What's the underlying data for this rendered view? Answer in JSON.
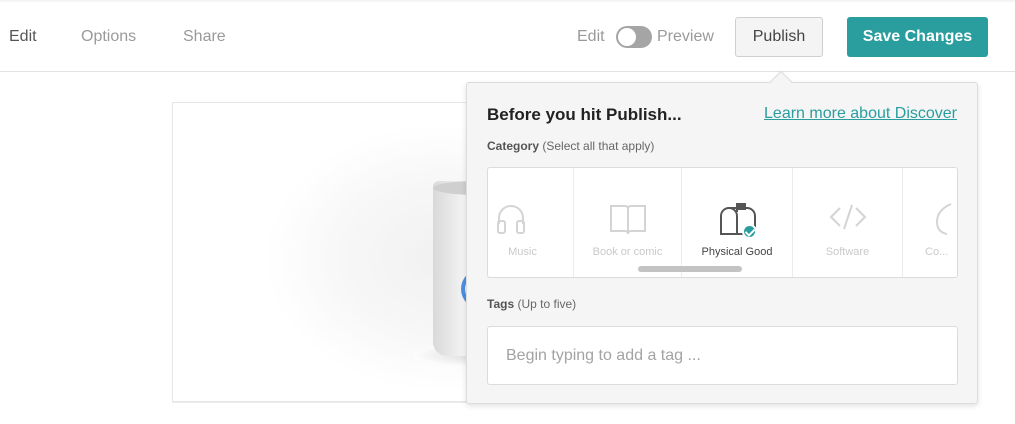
{
  "nav": {
    "edit": "Edit",
    "options": "Options",
    "share": "Share"
  },
  "mode": {
    "edit_label": "Edit",
    "preview_label": "Preview",
    "toggle_state": "edit"
  },
  "toolbar": {
    "publish_label": "Publish",
    "save_label": "Save Changes"
  },
  "colors": {
    "accent": "#2a9d9f",
    "link": "#2a9d9f"
  },
  "popover": {
    "title": "Before you hit Publish...",
    "learn_more": "Learn more about Discover",
    "category": {
      "label": "Category",
      "hint": "(Select all that apply)",
      "items": [
        {
          "label": "Music",
          "icon": "headphones-icon",
          "selected": false
        },
        {
          "label": "Book or comic",
          "icon": "book-icon",
          "selected": false
        },
        {
          "label": "Physical Good",
          "icon": "mailbox-icon",
          "selected": true
        },
        {
          "label": "Software",
          "icon": "code-icon",
          "selected": false
        },
        {
          "label": "Co...",
          "icon": "partial-icon",
          "selected": false
        }
      ]
    },
    "tags": {
      "label": "Tags",
      "hint": "(Up to five)",
      "placeholder": "Begin typing to add a tag ...",
      "value": ""
    }
  }
}
